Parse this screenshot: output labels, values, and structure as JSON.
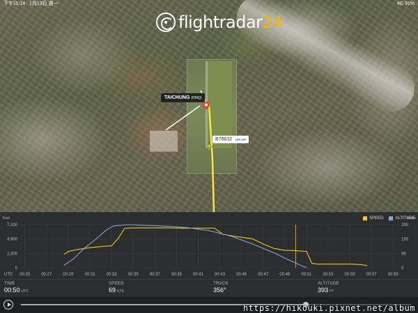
{
  "statusbar": {
    "time": "下午11:14",
    "date": "1月13日 週一",
    "signal": "4G",
    "battery": "91%"
  },
  "logo": {
    "text": "flightradar",
    "num": "24"
  },
  "map": {
    "airport_name": "TAICHUNG",
    "airport_code": "(RMQ)",
    "aircraft_reg": "B78632",
    "airline": "UNI AIR"
  },
  "chart_data": {
    "type": "line",
    "legend": [
      "SPEED",
      "ALTITUDE"
    ],
    "left_axis_label": "Feet",
    "right_axis_label": "Knots",
    "left_ticks": [
      "7,200",
      "4,800",
      "2,400",
      "0"
    ],
    "right_ticks": [
      "290",
      "193",
      "96",
      "0"
    ],
    "utc_label": "UTC",
    "x_ticks": [
      "00:25",
      "00:27",
      "00:29",
      "00:31",
      "00:33",
      "00:35",
      "00:37",
      "00:39",
      "00:41",
      "00:43",
      "00:45",
      "00:47",
      "00:49",
      "00:51",
      "00:53",
      "00:55",
      "00:57",
      "00:59"
    ],
    "xlim_minutes": [
      24.5,
      59.5
    ],
    "ylim_feet": [
      0,
      7200
    ],
    "ylim_knots": [
      0,
      290
    ],
    "marker_minute": 50.0,
    "series": [
      {
        "name": "SPEED",
        "color": "#f5c518",
        "points": [
          [
            28.6,
            90
          ],
          [
            29.0,
            110
          ],
          [
            30.0,
            125
          ],
          [
            31.0,
            135
          ],
          [
            32.0,
            142
          ],
          [
            33.0,
            148
          ],
          [
            33.6,
            195
          ],
          [
            34.2,
            265
          ],
          [
            35.0,
            268
          ],
          [
            38.0,
            268
          ],
          [
            40.0,
            266
          ],
          [
            42.5,
            266
          ],
          [
            43.3,
            225
          ],
          [
            44.5,
            210
          ],
          [
            45.5,
            200
          ],
          [
            46.0,
            195
          ],
          [
            47.0,
            160
          ],
          [
            48.0,
            130
          ],
          [
            49.0,
            118
          ],
          [
            50.0,
            115
          ],
          [
            51.0,
            110
          ],
          [
            51.5,
            30
          ],
          [
            52.0,
            25
          ],
          [
            55.0,
            25
          ],
          [
            56.0,
            22
          ],
          [
            56.6,
            15
          ]
        ]
      },
      {
        "name": "ALTITUDE",
        "color": "#7fa8d8",
        "points": [
          [
            28.6,
            400
          ],
          [
            29.5,
            1500
          ],
          [
            30.5,
            3300
          ],
          [
            31.5,
            4700
          ],
          [
            32.5,
            6300
          ],
          [
            33.2,
            7000
          ],
          [
            34.5,
            7200
          ],
          [
            36.0,
            7100
          ],
          [
            38.0,
            6950
          ],
          [
            40.0,
            6700
          ],
          [
            42.0,
            6200
          ],
          [
            44.0,
            5300
          ],
          [
            46.0,
            4000
          ],
          [
            48.0,
            2500
          ],
          [
            49.5,
            1200
          ],
          [
            50.5,
            400
          ],
          [
            51.0,
            0
          ]
        ]
      }
    ]
  },
  "stats": [
    {
      "label": "TIME",
      "value": "00:50",
      "unit": "UTC"
    },
    {
      "label": "SPEED",
      "value": "69",
      "unit": "KTS"
    },
    {
      "label": "TRACK",
      "value": "356°",
      "unit": ""
    },
    {
      "label": "ALTITUDE",
      "value": "393",
      "unit": "FT"
    }
  ],
  "playback": {
    "progress": 0.73
  },
  "watermark": "https://hikouki.pixnet.net/album"
}
